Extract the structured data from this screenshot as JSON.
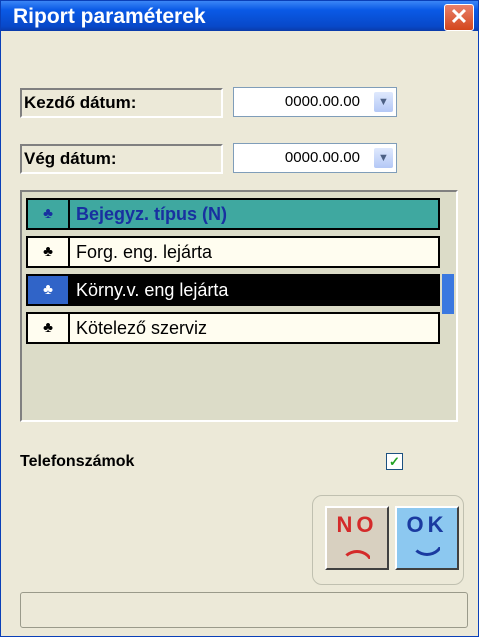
{
  "window": {
    "title": "Riport paraméterek",
    "close_glyph": "✕"
  },
  "start_date": {
    "label": "Kezdő dátum:",
    "value": "0000.00.00"
  },
  "end_date": {
    "label": "Vég dátum:",
    "value": "0000.00.00"
  },
  "grid": {
    "header": {
      "icon": "♣",
      "label": "Bejegyz. típus (N)"
    },
    "rows": [
      {
        "icon": "♣",
        "label": "Forg. eng. lejárta"
      },
      {
        "icon": "♣",
        "label": "Körny.v. eng lejárta"
      },
      {
        "icon": "♣",
        "label": "Kötelező szerviz"
      }
    ]
  },
  "phones": {
    "label": "Telefonszámok",
    "checked": true,
    "check_glyph": "✓"
  },
  "buttons": {
    "no_label": "NO",
    "ok_label": "OK"
  },
  "colors": {
    "title_bar": "#0a5ae6",
    "grid_header": "#3fa8a0",
    "selected_row": "#000000",
    "no_color": "#d42a2a",
    "ok_color": "#1a3aa0"
  }
}
